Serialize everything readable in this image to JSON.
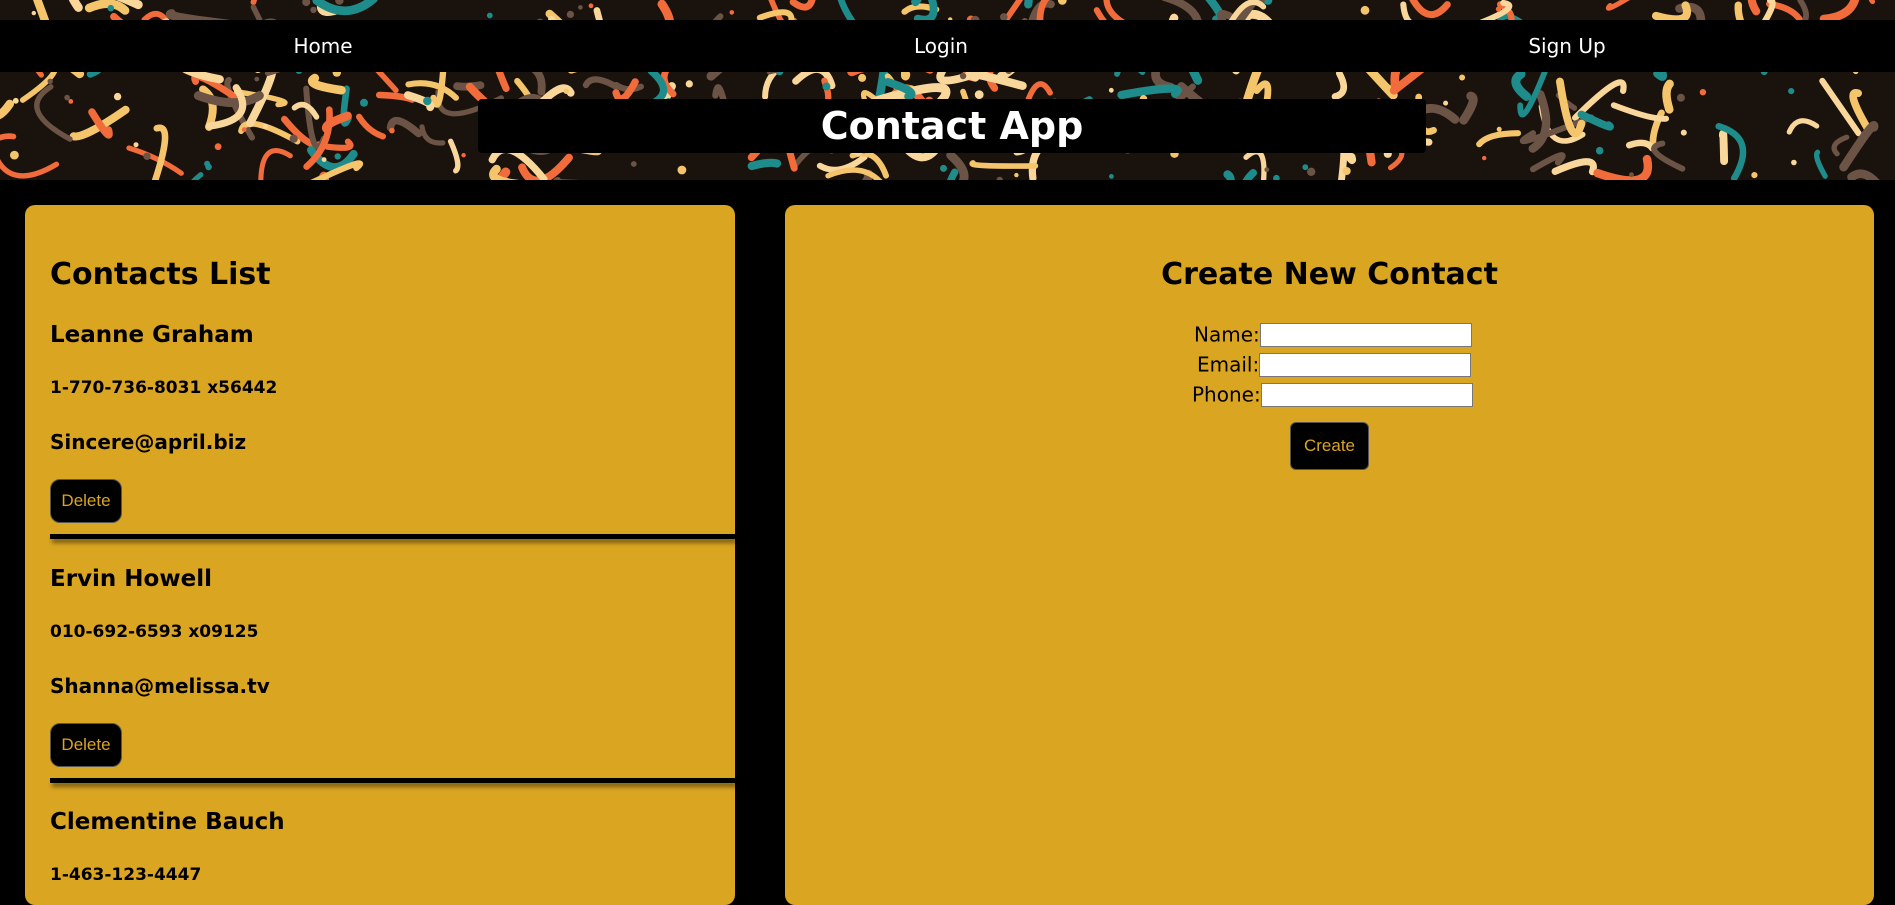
{
  "nav": {
    "home_label": "Home",
    "login_label": "Login",
    "signup_label": "Sign Up"
  },
  "app": {
    "title": "Contact App"
  },
  "contacts_list": {
    "heading": "Contacts List",
    "delete_label": "Delete",
    "items": [
      {
        "name": "Leanne Graham",
        "phone": "1-770-736-8031 x56442",
        "email": "Sincere@april.biz"
      },
      {
        "name": "Ervin Howell",
        "phone": "010-692-6593 x09125",
        "email": "Shanna@melissa.tv"
      },
      {
        "name": "Clementine Bauch",
        "phone": "1-463-123-4447",
        "email": ""
      }
    ]
  },
  "create_form": {
    "heading": "Create New Contact",
    "name_label": "Name:",
    "name_value": "",
    "email_label": "Email:",
    "email_value": "",
    "phone_label": "Phone:",
    "phone_value": "",
    "submit_label": "Create"
  },
  "colors": {
    "panel": "#DAA520",
    "background": "#000000",
    "button_text": "#DAA520",
    "pattern": [
      "#F26B3A",
      "#F5C56B",
      "#1F8C8C",
      "#6B5446",
      "#F9D79A"
    ]
  }
}
